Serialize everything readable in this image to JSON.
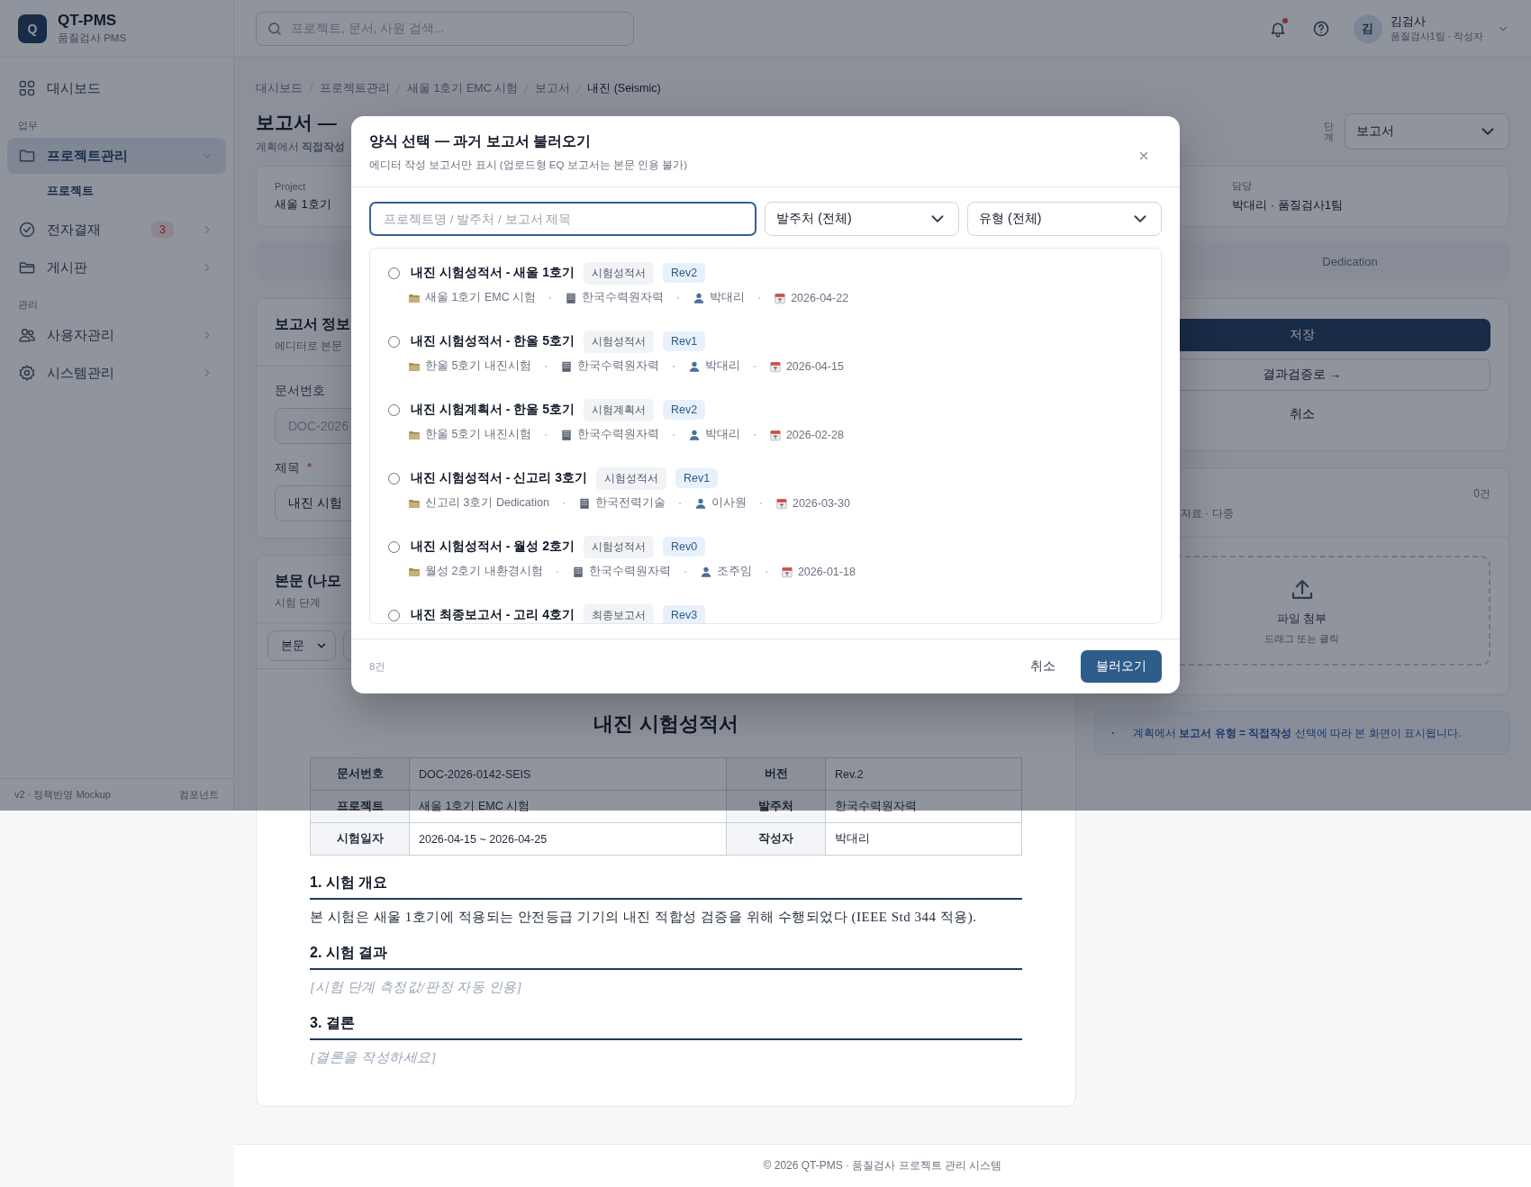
{
  "sidebar": {
    "logo_letter": "Q",
    "app_name": "QT-PMS",
    "app_subtitle": "품질검사 PMS",
    "items": [
      {
        "kind": "link",
        "label": "대시보드",
        "selected": false
      },
      {
        "kind": "section",
        "label": "업무"
      },
      {
        "kind": "group",
        "label": "프로젝트관리",
        "selected": true,
        "expanded": true,
        "children": [
          {
            "label": "프로젝트",
            "selected": true
          }
        ]
      },
      {
        "kind": "group",
        "label": "전자결재",
        "badge": "3",
        "selected": false,
        "expanded": false
      },
      {
        "kind": "group",
        "label": "게시판",
        "selected": false,
        "expanded": false
      },
      {
        "kind": "section",
        "label": "관리"
      },
      {
        "kind": "group",
        "label": "사용자관리",
        "selected": false,
        "expanded": false
      },
      {
        "kind": "group",
        "label": "시스템관리",
        "selected": false,
        "expanded": false
      }
    ],
    "footer_left": "v2 · 정책반영 Mockup",
    "footer_right": "컴포넌트"
  },
  "header": {
    "search": {
      "placeholder": "프로젝트, 문서, 사원 검색..."
    },
    "has_unread": true,
    "user": {
      "avatar": "김",
      "name": "김검사",
      "role": "품질검사1팀 · 작성자"
    }
  },
  "page": {
    "breadcrumb": [
      "대시보드",
      "프로젝트관리",
      "새울 1호기 EMC 시험",
      "보고서",
      "내진 (Seismic)"
    ],
    "title": "보고서 —",
    "subtitle": "계획에서 **직접작성**",
    "stage": {
      "label": "단계",
      "value": "보고서"
    },
    "project_fields": [
      {
        "label": "Project",
        "value": "새울 1호기"
      },
      {
        "label": "담당",
        "value": "박대리 · 품질검사1팀"
      }
    ],
    "tabs": [
      {
        "label": "Dedication",
        "selected": false
      }
    ],
    "info_card": {
      "title": "보고서 정보",
      "subtitle": "에디터로 본문",
      "fields": [
        {
          "label": "문서번호",
          "value": "DOC-2026",
          "disabled": true
        },
        {
          "label": "제목",
          "value": "내진 시험",
          "required_mark": "*",
          "disabled": false
        }
      ]
    },
    "editor": {
      "title": "본문 (나모",
      "subtitle": "시험 단계",
      "block_select": "본문",
      "document": {
        "title": "내진 시험성적서",
        "table": [
          [
            "문서번호",
            "DOC-2026-0142-SEIS",
            "버전",
            "Rev.2"
          ],
          [
            "프로젝트",
            "새울 1호기 EMC 시험",
            "발주처",
            "한국수력원자력"
          ],
          [
            "시험일자",
            "2026-04-15 ~ 2026-04-25",
            "작성자",
            "박대리"
          ]
        ],
        "sections": [
          {
            "heading": "1. 시험 개요",
            "kind": "text",
            "body": "본 시험은 새울 1호기에 적용되는 안전등급 기기의 내진 적합성 검증을 위해 수행되었다 (IEEE Std 344 적용)."
          },
          {
            "heading": "2. 시험 결과",
            "kind": "placeholder",
            "body": "[시험 단계 측정값/판정 자동 인용]"
          },
          {
            "heading": "3. 결론",
            "kind": "placeholder",
            "body": "[결론을 작성하세요]"
          }
        ]
      }
    },
    "actions": [
      {
        "kind": "primary",
        "label": "저장"
      },
      {
        "kind": "outline",
        "label": "결과검증로 →"
      },
      {
        "kind": "plain",
        "label": "취소"
      }
    ],
    "attachments": {
      "subtitle": "자료 · 다중",
      "count": "0건",
      "drop_title": "파일 첨부",
      "drop_hint": "드래그 또는 클릭"
    },
    "note": {
      "marker": "·",
      "text": "계획에서 **보고서 유형 = 직접작성** 선택에 따라 본 화면이 표시됩니다."
    }
  },
  "footer": "© 2026 QT-PMS · 품질검사 프로젝트 관리 시스템",
  "modal": {
    "title": "양식 선택 — 과거 보고서 불러오기",
    "subtitle": "에디터 작성 보고서만 표시 (업로드형 EQ 보고서는 본문 인용 불가)",
    "search": {
      "placeholder": "프로젝트명 / 발주처 / 보고서 제목"
    },
    "filters": [
      "발주처 (전체)",
      "유형 (전체)"
    ],
    "items": [
      {
        "title": "내진 시험성적서 - 새울 1호기",
        "type": "시험성적서",
        "rev": "Rev2",
        "selected": false,
        "meta": {
          "project": "새울 1호기 EMC 시험",
          "client": "한국수력원자력",
          "author": "박대리",
          "date": "2026-04-22"
        }
      },
      {
        "title": "내진 시험성적서 - 한울 5호기",
        "type": "시험성적서",
        "rev": "Rev1",
        "selected": false,
        "meta": {
          "project": "한울 5호기 내진시험",
          "client": "한국수력원자력",
          "author": "박대리",
          "date": "2026-04-15"
        }
      },
      {
        "title": "내진 시험계획서 - 한울 5호기",
        "type": "시험계획서",
        "rev": "Rev2",
        "selected": false,
        "meta": {
          "project": "한울 5호기 내진시험",
          "client": "한국수력원자력",
          "author": "박대리",
          "date": "2026-02-28"
        }
      },
      {
        "title": "내진 시험성적서 - 신고리 3호기",
        "type": "시험성적서",
        "rev": "Rev1",
        "selected": false,
        "meta": {
          "project": "신고리 3호기 Dedication",
          "client": "한국전력기술",
          "author": "이사원",
          "date": "2026-03-30"
        }
      },
      {
        "title": "내진 시험성적서 - 월성 2호기",
        "type": "시험성적서",
        "rev": "Rev0",
        "selected": false,
        "meta": {
          "project": "월성 2호기 내환경시험",
          "client": "한국수력원자력",
          "author": "조주임",
          "date": "2026-01-18"
        }
      },
      {
        "title": "내진 최종보고서 - 고리 4호기",
        "type": "최종보고서",
        "rev": "Rev3",
        "selected": false
      }
    ],
    "count": "8건",
    "cancel": "취소",
    "confirm": "불러오기"
  }
}
